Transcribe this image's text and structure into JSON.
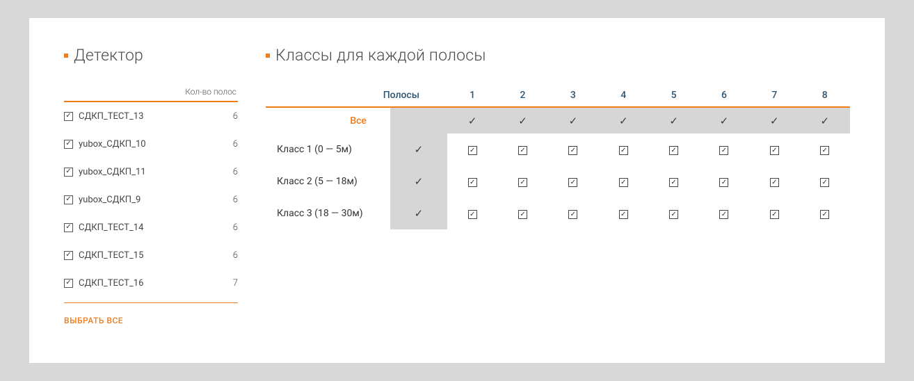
{
  "detector": {
    "title": "Детектор",
    "count_column": "Кол-во полос",
    "items": [
      {
        "name": "СДКП_ТЕСТ_13",
        "lanes": 6,
        "checked": true
      },
      {
        "name": "yubox_СДКП_10",
        "lanes": 6,
        "checked": true
      },
      {
        "name": "yubox_СДКП_11",
        "lanes": 6,
        "checked": true
      },
      {
        "name": "yubox_СДКП_9",
        "lanes": 6,
        "checked": true
      },
      {
        "name": "СДКП_ТЕСТ_14",
        "lanes": 6,
        "checked": true
      },
      {
        "name": "СДКП_ТЕСТ_15",
        "lanes": 6,
        "checked": true
      },
      {
        "name": "СДКП_ТЕСТ_16",
        "lanes": 7,
        "checked": true
      }
    ],
    "select_all_label": "ВЫБРАТЬ ВСЕ"
  },
  "matrix": {
    "title": "Классы для каждой полосы",
    "lanes_header": "Полосы",
    "all_label": "Все",
    "lane_numbers": [
      "1",
      "2",
      "3",
      "4",
      "5",
      "6",
      "7",
      "8"
    ],
    "all_row_checks": [
      true,
      true,
      true,
      true,
      true,
      true,
      true,
      true
    ],
    "classes": [
      {
        "label": "Класс 1 (0 — 5м)",
        "all": true,
        "lanes": [
          true,
          true,
          true,
          true,
          true,
          true,
          true,
          true
        ]
      },
      {
        "label": "Класс 2 (5 — 18м)",
        "all": true,
        "lanes": [
          true,
          true,
          true,
          true,
          true,
          true,
          true,
          true
        ]
      },
      {
        "label": "Класс 3 (18 — 30м)",
        "all": true,
        "lanes": [
          true,
          true,
          true,
          true,
          true,
          true,
          true,
          true
        ]
      }
    ]
  },
  "colors": {
    "accent": "#ee7b1c",
    "header_text": "#2d5472",
    "shade": "#d6d6d6"
  }
}
